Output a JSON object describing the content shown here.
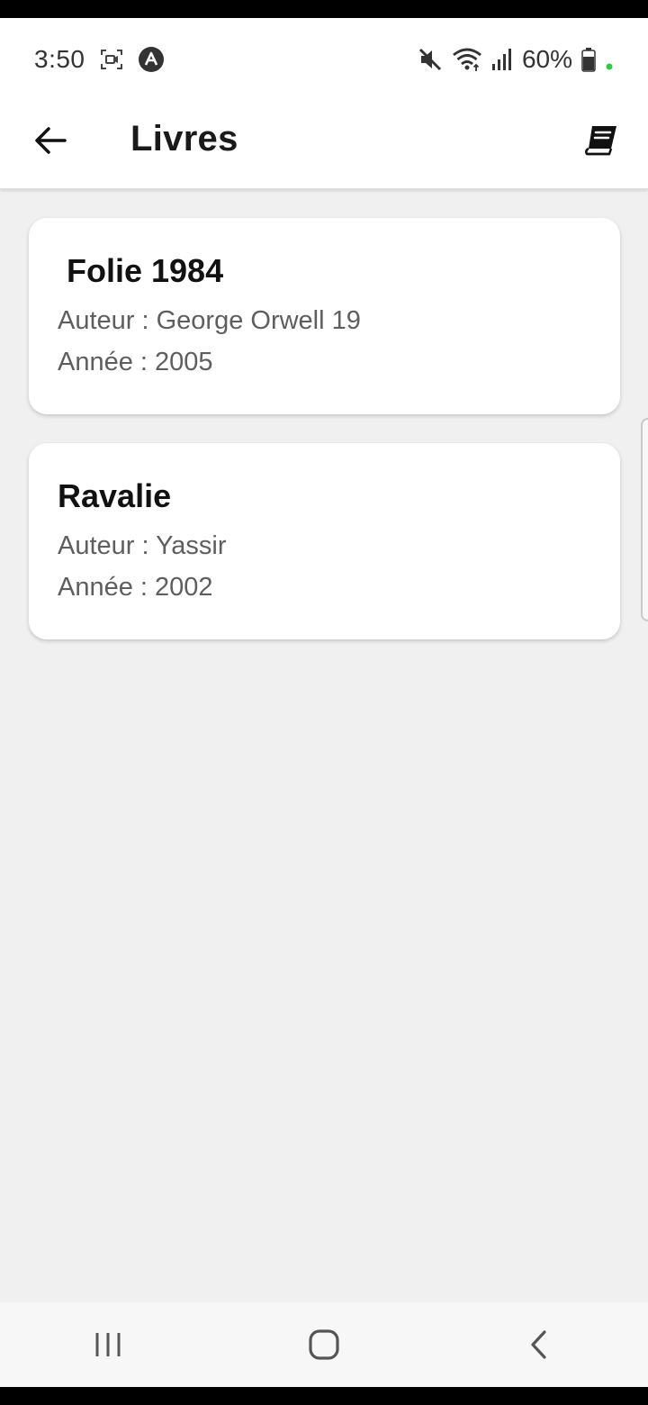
{
  "status_bar": {
    "time": "3:50",
    "battery_percent": "60%",
    "icons": [
      "screen-record-icon",
      "app-notification-icon",
      "mute-icon",
      "wifi-icon",
      "signal-icon",
      "battery-icon",
      "dot-indicator-icon"
    ],
    "dot_color": "#2ecc40"
  },
  "header": {
    "title": "Livres",
    "back_icon": "arrow-left-icon",
    "action_icon": "book-icon"
  },
  "books": [
    {
      "title": "Folie 1984",
      "author": "Auteur : George Orwell 19",
      "year": "Année : 2005"
    },
    {
      "title": "Ravalie",
      "author": "Auteur : Yassir",
      "year": "Année : 2002"
    }
  ],
  "nav_bar": {
    "icons": [
      "recent-apps-icon",
      "home-icon",
      "back-nav-icon"
    ]
  },
  "colors": {
    "background": "#f0f0f0",
    "card": "#ffffff",
    "title_text": "#111111",
    "meta_text": "#5e5e5e"
  }
}
